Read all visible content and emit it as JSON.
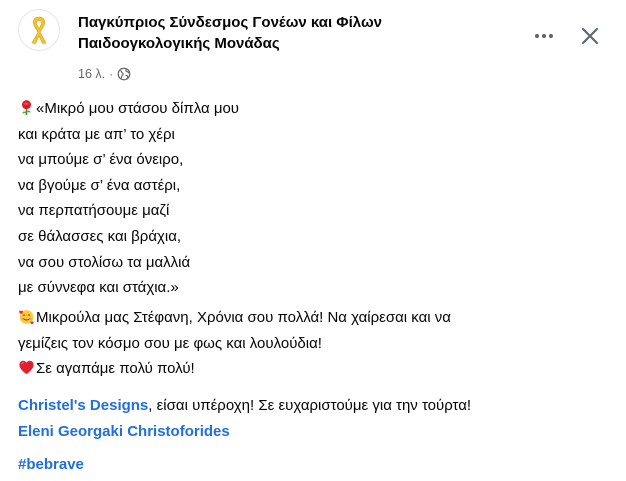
{
  "post": {
    "page_name_line1": "Παγκύπριος Σύνδεσμος Γονέων και Φίλων",
    "page_name_line2": "Παιδοογκολογικής Μονάδας",
    "timestamp": "16 λ.",
    "separator": "·",
    "privacy_icon": "globe-icon",
    "more_icon": "more-dots-icon",
    "close_icon": "close-icon"
  },
  "poem": {
    "lead_emoji": "rose-emoji",
    "lines": [
      "«Μικρό μου στάσου δίπλα μου",
      "και κράτα με απ’ το χέρι",
      "να μπούμε σ’ ένα όνειρο,",
      "να βγούμε σ’ ένα αστέρι,",
      "να περπατήσουμε μαζί",
      "σε θάλασσες και βράχια,",
      "να σου στολίσω τα μαλλιά",
      "με σύννεφα και στάχια.»"
    ]
  },
  "wishes": {
    "emoji1": "smiling-face-with-hearts-emoji",
    "line1": "Μικρούλα μας Στέφανη, Χρόνια σου πολλά! Να χαίρεσαι και να",
    "line2": "γεμίζεις τον κόσμο σου με φως και λουλούδια!",
    "emoji2": "red-heart-emoji",
    "line3": "Σε αγαπάμε πολύ πολύ!"
  },
  "mentions": {
    "mention1": "Christel's Designs",
    "mention1_text": ", είσαι υπέροχη! Σε ευχαριστούμε για την τούρτα!",
    "mention2": "Eleni Georgaki Christoforides"
  },
  "hashtag": "#bebrave",
  "colors": {
    "link": "#216fdb",
    "text": "#050505",
    "secondary": "#65676b",
    "ribbon": "#f2c230"
  }
}
